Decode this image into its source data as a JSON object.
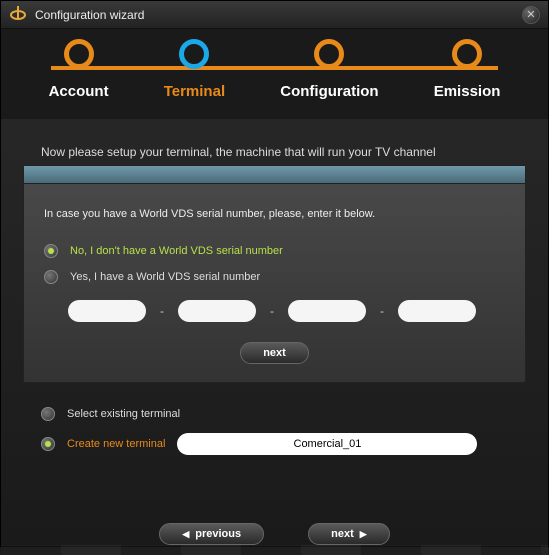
{
  "titlebar": {
    "title": "Configuration wizard"
  },
  "steps": [
    {
      "label": "Account"
    },
    {
      "label": "Terminal"
    },
    {
      "label": "Configuration"
    },
    {
      "label": "Emission"
    }
  ],
  "intro": "Now please setup your terminal, the machine that will run your TV channel",
  "panel": {
    "message": "In case you have a World VDS serial number, please, enter it below.",
    "option_no": "No, I don't have a World VDS serial number",
    "option_yes": "Yes, I have a World VDS serial number",
    "dash": "-",
    "next": "next"
  },
  "lower": {
    "select_existing": "Select existing terminal",
    "create_new": "Create new terminal",
    "terminal_value": "Comercial_01"
  },
  "footer": {
    "previous": "previous",
    "next": "next"
  }
}
